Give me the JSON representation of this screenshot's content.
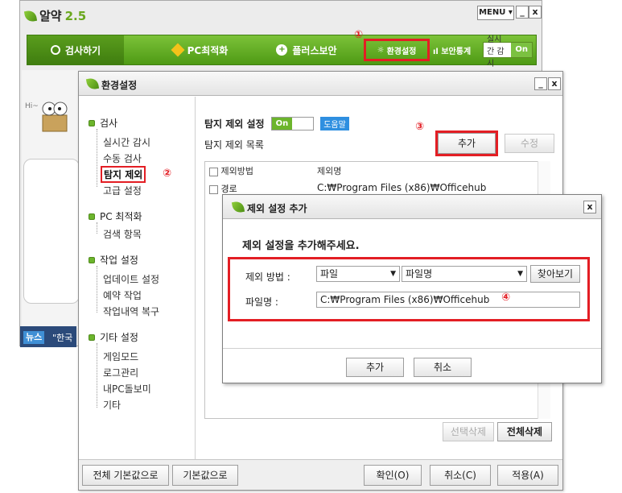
{
  "app": {
    "title": "알약",
    "version": "2.5",
    "menu_label": "MENU ▾",
    "minimize": "_",
    "close": "x",
    "nav": [
      {
        "label": "검사하기"
      },
      {
        "label": "PC최적화"
      },
      {
        "label": "플러스보안"
      }
    ],
    "settings_tab": "환경설정",
    "security_stats": "보안통계",
    "realtime_label": "실시간 감시",
    "realtime_state": "On",
    "greeting": "Hi~",
    "news_badge": "뉴스",
    "news_text": "\"한국"
  },
  "settings": {
    "title": "환경설정",
    "sidebar": {
      "groups": [
        {
          "label": "검사",
          "items": [
            "실시간 감시",
            "수동 검사",
            "탐지 제외",
            "고급 설정"
          ]
        },
        {
          "label": "PC 최적화",
          "items": [
            "검색 항목"
          ]
        },
        {
          "label": "작업 설정",
          "items": [
            "업데이트 설정",
            "예약 작업",
            "작업내역 복구"
          ]
        },
        {
          "label": "기타 설정",
          "items": [
            "게임모드",
            "로그관리",
            "내PC돌보미",
            "기타"
          ]
        }
      ],
      "selected": "탐지 제외"
    },
    "exclude": {
      "title": "탐지 제외 설정",
      "toggle": "On",
      "help": "도움말",
      "list_label": "탐지 제외 목록",
      "add_button": "추가",
      "edit_button": "수정",
      "columns": [
        "제외방법",
        "제외명"
      ],
      "rows": [
        {
          "method": "경로",
          "name": "C:₩Program Files (x86)₩Officehub"
        }
      ],
      "delete_selected": "선택삭제",
      "delete_all": "전체삭제"
    },
    "footer": {
      "reset_all": "전체 기본값으로",
      "reset": "기본값으로",
      "ok": "확인(O)",
      "cancel": "취소(C)",
      "apply": "적용(A)"
    }
  },
  "add_dialog": {
    "title": "제외 설정 추가",
    "close": "x",
    "prompt": "제외 설정을 추가해주세요.",
    "method_label": "제외 방법 :",
    "method_value": "파일",
    "name_type_value": "파일명",
    "browse_button": "찾아보기",
    "filename_label": "파일명 :",
    "filename_value": "C:₩Program Files (x86)₩Officehub",
    "add_button": "추가",
    "cancel_button": "취소"
  },
  "annotations": {
    "n1": "①",
    "n2": "②",
    "n3": "③",
    "n4": "④"
  },
  "colors": {
    "accent_green": "#6cb52c",
    "highlight_red": "#e31e24",
    "help_blue": "#2e8fe0"
  }
}
